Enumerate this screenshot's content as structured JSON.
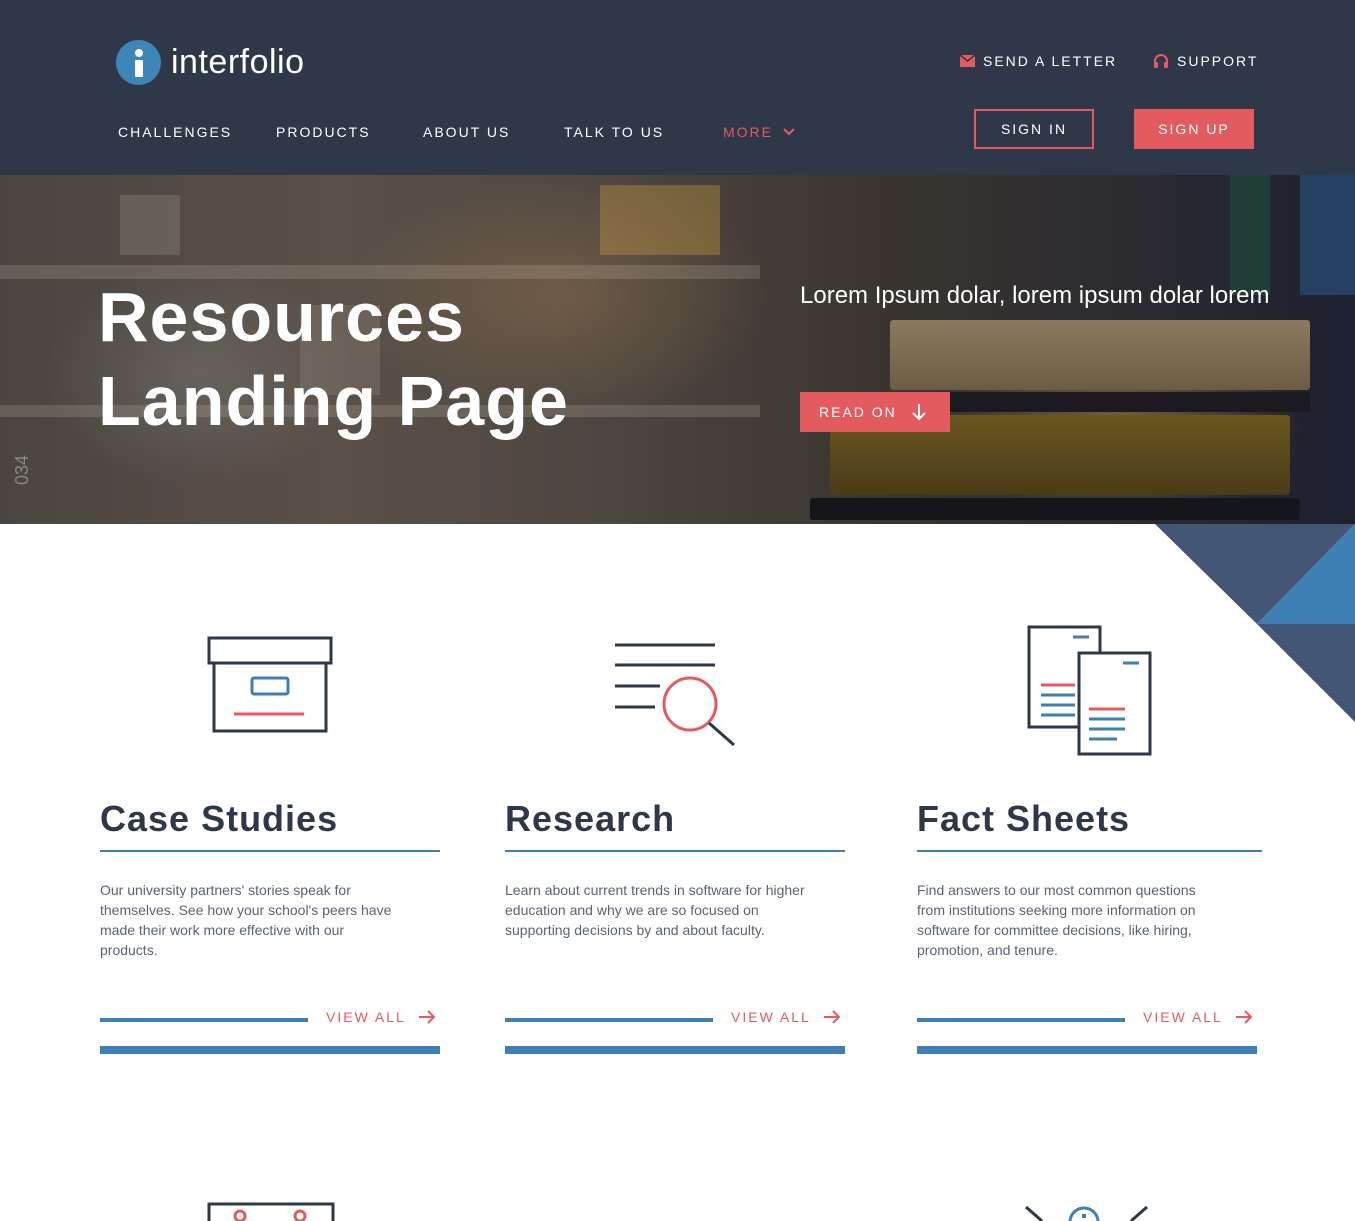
{
  "header": {
    "logo_text": "interfolio",
    "util": {
      "send_letter": "SEND A LETTER",
      "support": "SUPPORT"
    },
    "nav": {
      "challenges": "CHALLENGES",
      "products": "PRODUCTS",
      "about": "ABOUT US",
      "talk": "TALK TO US",
      "more": "MORE"
    },
    "sign_in": "SIGN IN",
    "sign_up": "SIGN UP"
  },
  "hero": {
    "title_line1": "Resources",
    "title_line2": "Landing Page",
    "subtitle": "Lorem Ipsum dolar, lorem ipsum dolar lorem",
    "read_on": "READ ON",
    "side_number": "034"
  },
  "cards": [
    {
      "title": "Case Studies",
      "description": "Our university partners' stories speak for themselves. See how your school's peers have made their work more effective with our products.",
      "view_all": "VIEW ALL",
      "icon": "archive-box-icon"
    },
    {
      "title": "Research",
      "description": "Learn about current trends in software for higher education and why we are so focused on supporting decisions by and about faculty.",
      "view_all": "VIEW ALL",
      "icon": "text-magnifier-icon"
    },
    {
      "title": "Fact Sheets",
      "description": "Find answers to our most common questions from institutions seeking more information on software for committee decisions, like hiring, promotion, and tenure.",
      "view_all": "VIEW ALL",
      "icon": "documents-icon"
    }
  ],
  "colors": {
    "header_bg": "#2e3849",
    "accent_red": "#e35b5f",
    "accent_blue": "#3f7fb3",
    "navy": "#2e3849",
    "triangle_slate": "#445675"
  }
}
